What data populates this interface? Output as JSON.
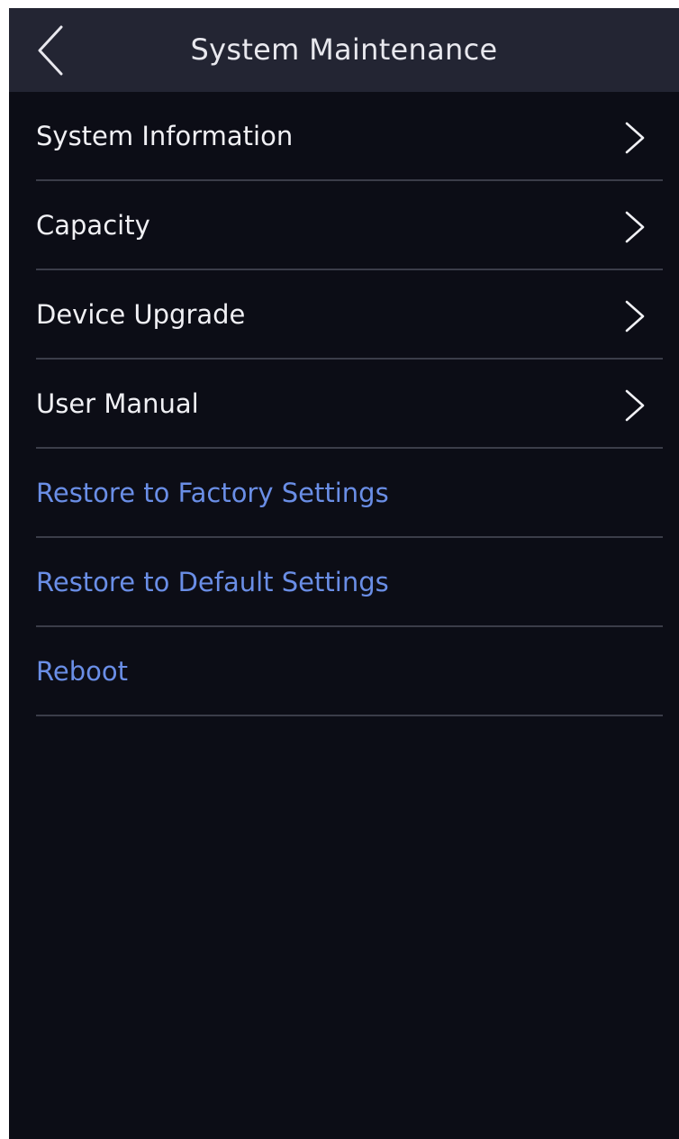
{
  "header": {
    "title": "System Maintenance",
    "back_icon": "chevron-left-icon"
  },
  "menu": {
    "items": [
      {
        "label": "System Information",
        "kind": "navigation",
        "icon": "chevron-right-icon"
      },
      {
        "label": "Capacity",
        "kind": "navigation",
        "icon": "chevron-right-icon"
      },
      {
        "label": "Device Upgrade",
        "kind": "navigation",
        "icon": "chevron-right-icon"
      },
      {
        "label": "User Manual",
        "kind": "navigation",
        "icon": "chevron-right-icon"
      },
      {
        "label": "Restore to Factory Settings",
        "kind": "action"
      },
      {
        "label": "Restore to Default Settings",
        "kind": "action"
      },
      {
        "label": "Reboot",
        "kind": "action"
      }
    ]
  },
  "colors": {
    "background": "#0c0d16",
    "header_background": "#232533",
    "text": "#f0f0f4",
    "action_text": "#6a8ee6",
    "divider": "#3b3d49"
  }
}
